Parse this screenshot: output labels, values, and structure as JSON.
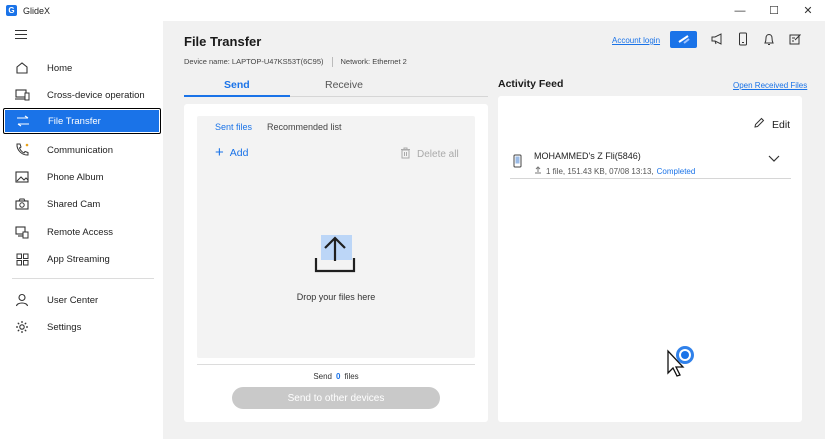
{
  "app": {
    "title": "GlideX",
    "logo_letter": "G"
  },
  "window_controls": {
    "minimize": "—",
    "maximize": "☐",
    "close": "✕"
  },
  "sidebar": {
    "items": [
      {
        "label": "Home",
        "icon": "home-icon"
      },
      {
        "label": "Cross-device operation",
        "icon": "cross-device-icon"
      },
      {
        "label": "File Transfer",
        "icon": "transfer-arrows-icon",
        "active": true
      },
      {
        "label": "Communication",
        "icon": "phone-icon"
      },
      {
        "label": "Phone Album",
        "icon": "album-icon"
      },
      {
        "label": "Shared Cam",
        "icon": "camera-icon"
      },
      {
        "label": "Remote Access",
        "icon": "remote-access-icon"
      },
      {
        "label": "App Streaming",
        "icon": "grid-icon"
      },
      {
        "label": "User Center",
        "icon": "user-icon"
      },
      {
        "label": "Settings",
        "icon": "gear-icon"
      }
    ]
  },
  "header": {
    "title": "File Transfer",
    "device_name": "Device name: LAPTOP-U47KS53T(6C95)",
    "network": "Network: Ethernet 2",
    "account_login": "Account login"
  },
  "tabs": {
    "send": "Send",
    "receive": "Receive"
  },
  "send_panel": {
    "subtab_sent": "Sent files",
    "subtab_recommended": "Recommended list",
    "add": "Add",
    "delete_all": "Delete all",
    "drop_text": "Drop your files here",
    "send_prefix": "Send",
    "send_count": "0",
    "send_suffix": "files",
    "send_button": "Send to other devices"
  },
  "activity_feed": {
    "title": "Activity Feed",
    "open_received": "Open Received Files",
    "edit": "Edit",
    "items": [
      {
        "name": "MOHAMMED's Z Fli(5846)",
        "meta": "1 file, 151.43 KB, 07/08 13:13,",
        "status": "Completed"
      }
    ]
  },
  "colors": {
    "accent": "#1a73e8",
    "panel_bg": "#f1f1f1",
    "disabled_button": "#c9c9c9"
  }
}
